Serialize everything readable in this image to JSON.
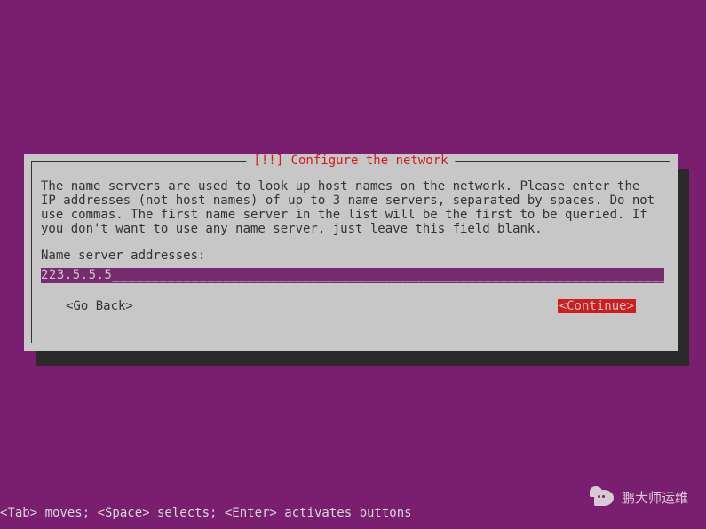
{
  "dialog": {
    "title": "[!!] Configure the network",
    "body": "The name servers are used to look up host names on the network. Please enter the IP addresses (not host names) of up to 3 name servers, separated by spaces. Do not use commas. The first name server in the list will be the first to be queried. If you don't want to use any name server, just leave this field blank.",
    "field_label": "Name server addresses:",
    "field_value": "223.5.5.5",
    "back_label": "<Go Back>",
    "continue_label": "<Continue>"
  },
  "footer": {
    "hint": "<Tab> moves; <Space> selects; <Enter> activates buttons"
  },
  "watermark": {
    "text": "鹏大师运维"
  }
}
